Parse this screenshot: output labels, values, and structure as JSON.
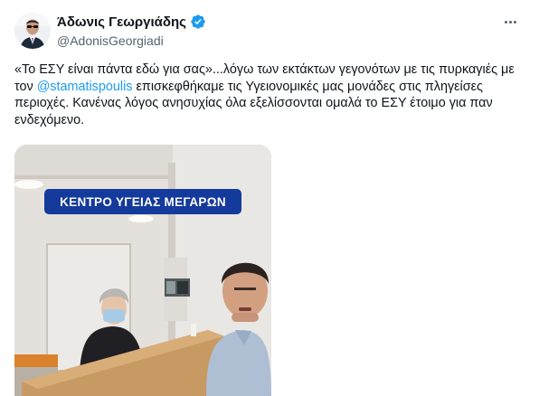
{
  "author": {
    "display_name": "Άδωνις Γεωργιάδης",
    "handle": "@AdonisGeorgiadi"
  },
  "tweet": {
    "text_part1": "«Το ΕΣΥ είναι πάντα εδώ για σας»...λόγω των εκτάκτων γεγονότων με τις πυρκαγιές με τον ",
    "mention": "@stamatispoulis",
    "text_part2": " επισκεφθήκαμε τις Υγειονομικές μας μονάδες στις πληγείσες περιοχές. Κανένας λόγος ανησυχίας όλα εξελίσσονται ομαλά το ΕΣΥ έτοιμο για παν ενδεχόμενο."
  },
  "media": {
    "banner_text": "ΚΕΝΤΡΟ ΥΓΕΙΑΣ ΜΕΓΑΡΩΝ"
  },
  "colors": {
    "accent": "#1d9bf0",
    "banner": "#143a9c",
    "text": "#0f1419",
    "secondary": "#536471"
  },
  "icons": [
    "verified-badge-icon",
    "more-options-icon"
  ]
}
